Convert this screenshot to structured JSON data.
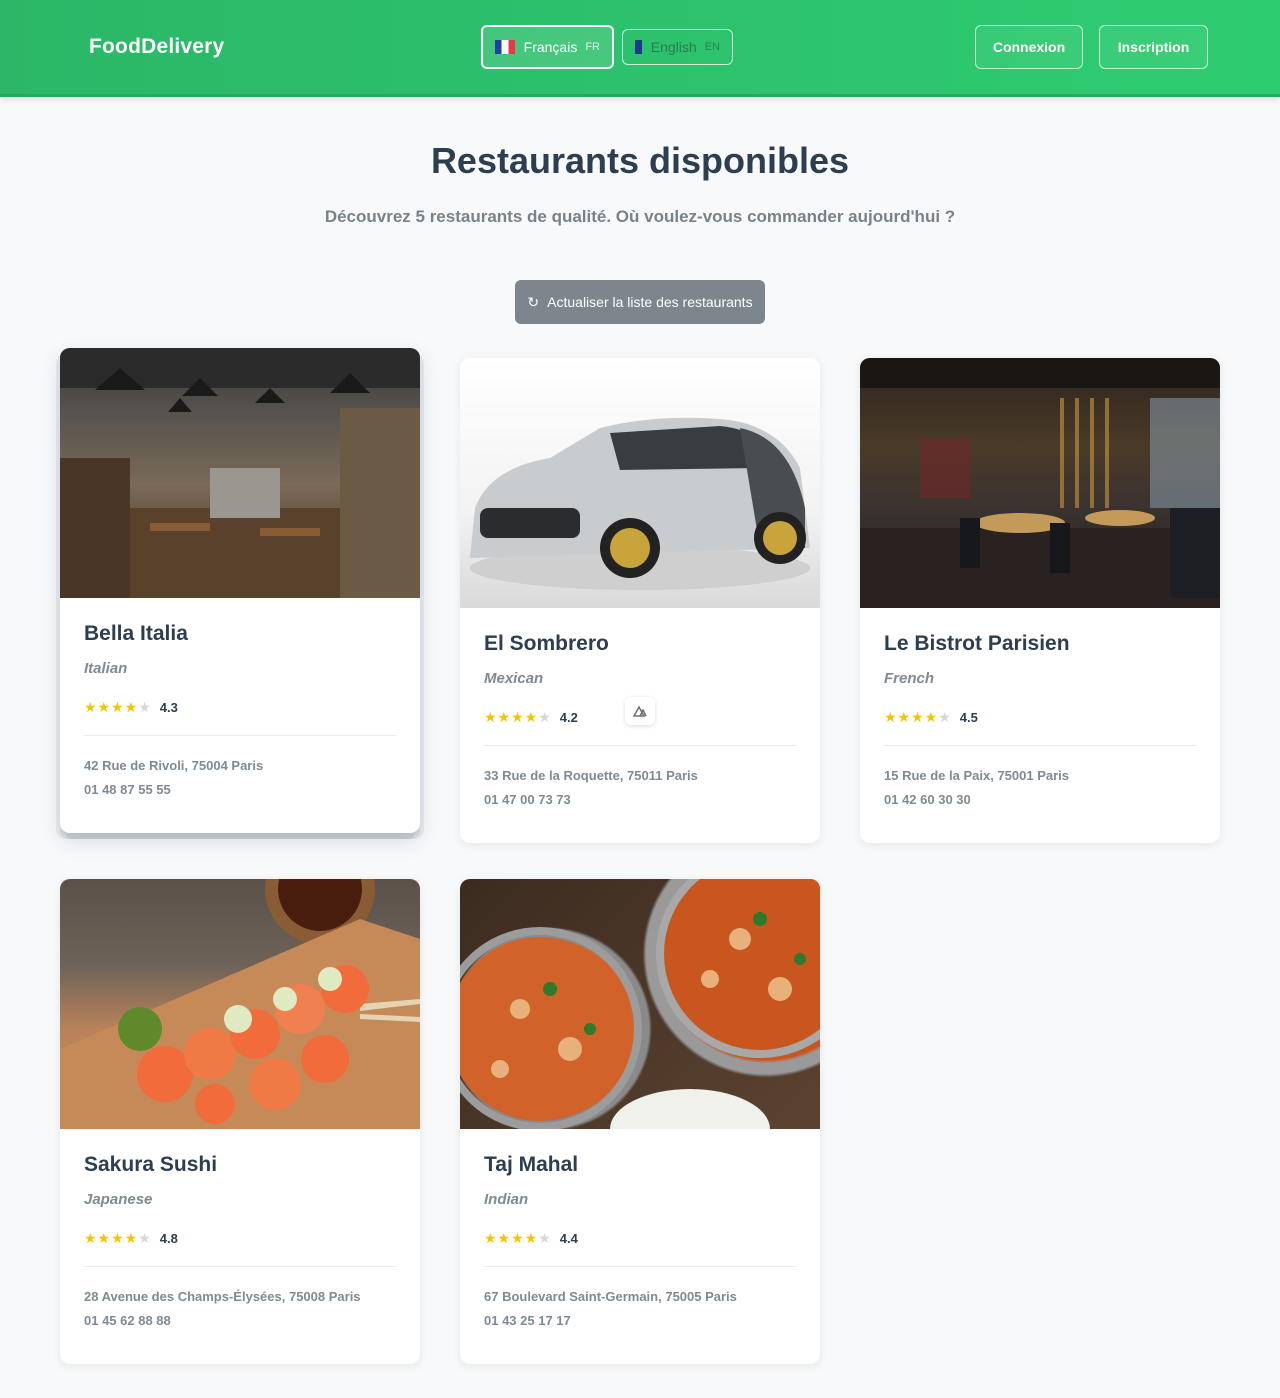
{
  "header": {
    "brand": "FoodDelivery",
    "languages": [
      {
        "label": "Français",
        "code": "FR",
        "flag": "flag-fr-icon",
        "active": true
      },
      {
        "label": "English",
        "code": "EN",
        "flag": "flag-en-icon",
        "active": false
      }
    ],
    "login_label": "Connexion",
    "signup_label": "Inscription"
  },
  "main": {
    "title": "Restaurants disponibles",
    "subtitle": "Découvrez 5 restaurants de qualité. Où voulez-vous commander aujourd'hui ?",
    "refresh_icon": "↻",
    "refresh_label": "Actualiser la liste des restaurants"
  },
  "restaurants": [
    {
      "name": "Bella Italia",
      "cuisine": "Italian",
      "stars": 4,
      "rating": "4.3",
      "address": "42 Rue de Rivoli, 75004 Paris",
      "phone": "01 48 87 55 55"
    },
    {
      "name": "El Sombrero",
      "cuisine": "Mexican",
      "stars": 4,
      "rating": "4.2",
      "address": "33 Rue de la Roquette, 75011 Paris",
      "phone": "01 47 00 73 73"
    },
    {
      "name": "Le Bistrot Parisien",
      "cuisine": "French",
      "stars": 4,
      "rating": "4.5",
      "address": "15 Rue de la Paix, 75001 Paris",
      "phone": "01 42 60 30 30"
    },
    {
      "name": "Sakura Sushi",
      "cuisine": "Japanese",
      "stars": 4,
      "rating": "4.8",
      "address": "28 Avenue des Champs-Élysées, 75008 Paris",
      "phone": "01 45 62 88 88"
    },
    {
      "name": "Taj Mahal",
      "cuisine": "Indian",
      "stars": 4,
      "rating": "4.4",
      "address": "67 Boulevard Saint-Germain, 75005 Paris",
      "phone": "01 43 25 17 17"
    }
  ],
  "colors": {
    "brand_green": "#2ecc71",
    "star": "#f5c400",
    "text_dark": "#2c3e50",
    "text_muted": "#7f8a92",
    "refresh_button": "#7d868d"
  }
}
